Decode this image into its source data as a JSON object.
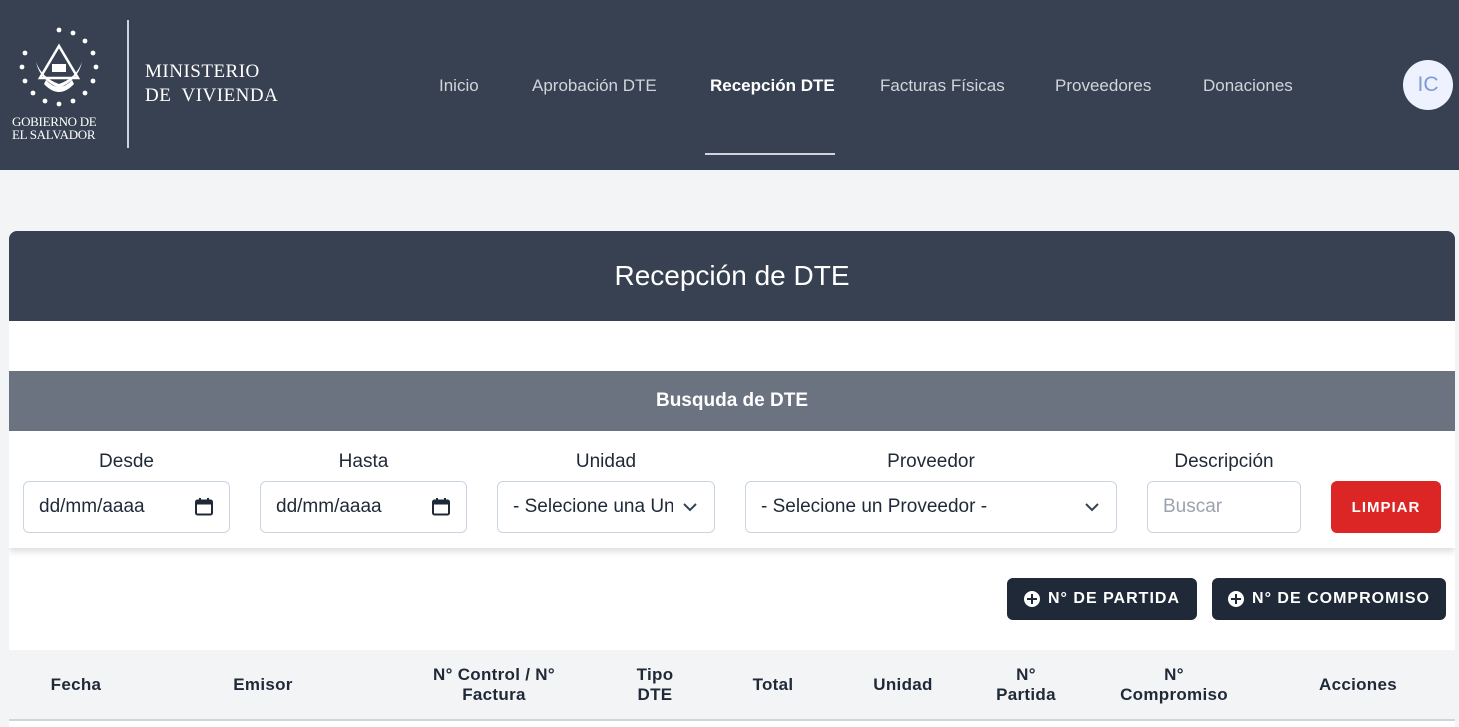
{
  "header": {
    "gov_text_line1": "GOBIERNO DE",
    "gov_text_line2": "EL SALVADOR",
    "ministry_line1": "MINISTERIO",
    "ministry_line2": "DE  VIVIENDA",
    "nav": [
      {
        "label": "Inicio",
        "active": false
      },
      {
        "label": "Aprobación DTE",
        "active": false
      },
      {
        "label": "Recepción DTE",
        "active": true
      },
      {
        "label": "Facturas Físicas",
        "active": false
      },
      {
        "label": "Proveedores",
        "active": false
      },
      {
        "label": "Donaciones",
        "active": false
      }
    ],
    "avatar_initials": "IC"
  },
  "page": {
    "title": "Recepción de DTE",
    "search_title": "Busquda de DTE"
  },
  "filters": {
    "desde": {
      "label": "Desde",
      "value": "dd/mm/aaaa",
      "icon": "calendar-icon"
    },
    "hasta": {
      "label": "Hasta",
      "value": "dd/mm/aaaa",
      "icon": "calendar-icon"
    },
    "unidad": {
      "label": "Unidad",
      "value": "- Selecione una Unidad -",
      "icon": "chevron-down-icon"
    },
    "proveedor": {
      "label": "Proveedor",
      "value": "- Selecione un Proveedor -",
      "icon": "chevron-down-icon"
    },
    "descripcion": {
      "label": "Descripción",
      "placeholder": "Buscar"
    },
    "clear_label": "LIMPIAR"
  },
  "actions": {
    "partida_label": "N° DE PARTIDA",
    "compromiso_label": "N° DE COMPROMISO"
  },
  "table": {
    "columns": [
      {
        "l1": "Fecha",
        "l2": ""
      },
      {
        "l1": "Emisor",
        "l2": ""
      },
      {
        "l1": "N° Control / N°",
        "l2": "Factura"
      },
      {
        "l1": "Tipo",
        "l2": "DTE"
      },
      {
        "l1": "Total",
        "l2": ""
      },
      {
        "l1": "Unidad",
        "l2": ""
      },
      {
        "l1": "N°",
        "l2": "Partida"
      },
      {
        "l1": "N°",
        "l2": "Compromiso"
      },
      {
        "l1": "Acciones",
        "l2": ""
      }
    ]
  },
  "colors": {
    "header_bg": "#374151",
    "search_bar_bg": "#6b7280",
    "danger": "#dc2626",
    "dark_button": "#1f2937"
  }
}
